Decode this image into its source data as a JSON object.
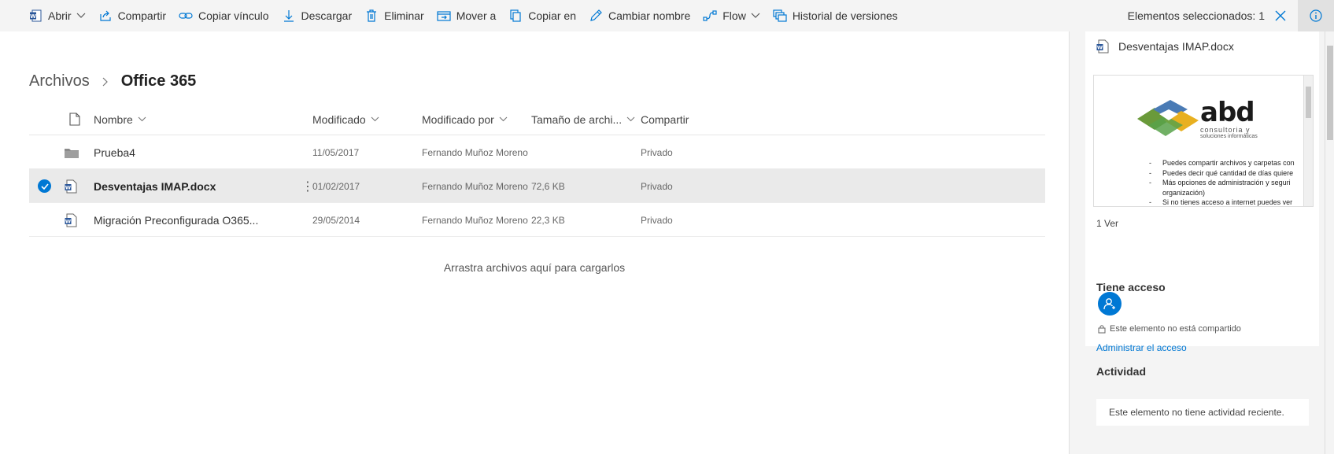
{
  "toolbar": {
    "open": "Abrir",
    "share": "Compartir",
    "copy_link": "Copiar vínculo",
    "download": "Descargar",
    "delete": "Eliminar",
    "move_to": "Mover a",
    "copy_to": "Copiar en",
    "rename": "Cambiar nombre",
    "flow": "Flow",
    "version_history": "Historial de versiones",
    "selected_count": "Elementos seleccionados: 1"
  },
  "breadcrumb": {
    "root": "Archivos",
    "current": "Office 365"
  },
  "columns": {
    "name": "Nombre",
    "modified": "Modificado",
    "modified_by": "Modificado por",
    "size": "Tamaño de archi...",
    "sharing": "Compartir"
  },
  "files": [
    {
      "icon": "folder-icon",
      "name": "Prueba4",
      "modified": "11/05/2017",
      "modified_by": "Fernando Muñoz Moreno",
      "size": "",
      "sharing": "Privado",
      "selected": false
    },
    {
      "icon": "word-doc-icon",
      "name": "Desventajas IMAP.docx",
      "modified": "01/02/2017",
      "modified_by": "Fernando Muñoz Moreno",
      "size": "72,6 KB",
      "sharing": "Privado",
      "selected": true
    },
    {
      "icon": "word-doc-icon",
      "name": "Migración Preconfigurada O365...",
      "modified": "29/05/2014",
      "modified_by": "Fernando Muñoz Moreno",
      "size": "22,3 KB",
      "sharing": "Privado",
      "selected": false
    }
  ],
  "drop_hint": "Arrastra archivos aquí para cargarlos",
  "details": {
    "file_name": "Desventajas IMAP.docx",
    "preview": {
      "logo_text": "abd",
      "logo_sub1": "consultoria y",
      "logo_sub2": "soluciones informáticas",
      "bullets": [
        "Puedes compartir archivos y carpetas con",
        "Puedes decir qué cantidad de días quiere",
        "Más opciones de administración y seguri",
        "organización)",
        "Si no tienes acceso a internet puedes ver"
      ]
    },
    "versions": "1 Ver",
    "access_title": "Tiene acceso",
    "not_shared": "Este elemento no está compartido",
    "manage_access": "Administrar el acceso",
    "activity_title": "Actividad",
    "no_activity": "Este elemento no tiene actividad reciente."
  },
  "colors": {
    "accent": "#0078d4",
    "selected_row": "#eaeaea",
    "toolbar_bg": "#f4f4f4"
  }
}
